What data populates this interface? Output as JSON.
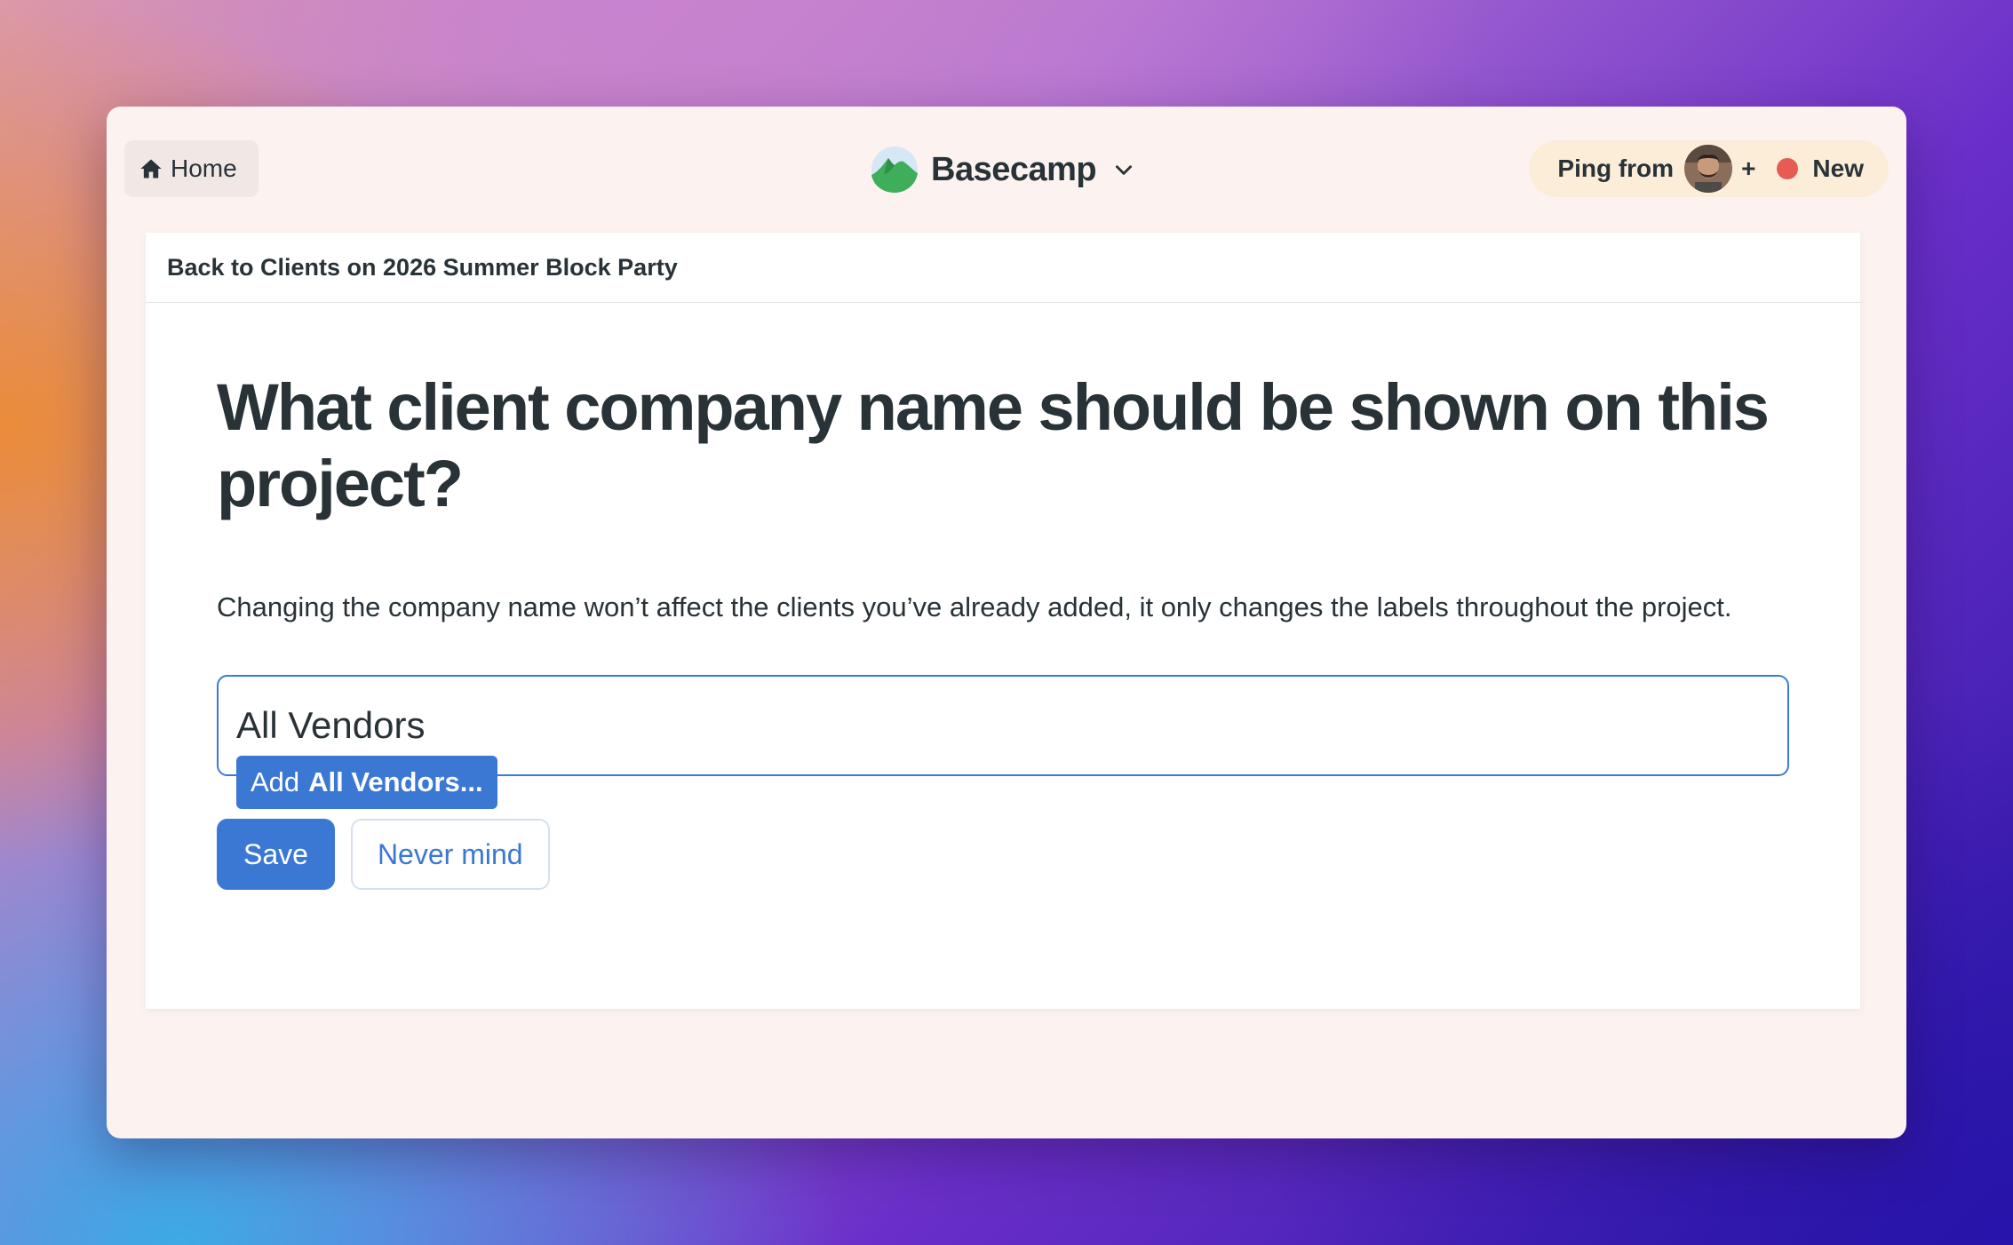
{
  "nav": {
    "home_label": "Home",
    "home_icon": "home-icon",
    "brand_name": "Basecamp",
    "ping_label": "Ping from",
    "plus_label": "+",
    "new_label": "New",
    "new_dot_color": "#e65c55"
  },
  "breadcrumb": {
    "label": "Back to Clients on 2026 Summer Block Party"
  },
  "form": {
    "heading": "What client company name should be shown on this project?",
    "description": "Changing the company name won’t affect the clients you’ve already added, it only changes the labels throughout the project.",
    "input_value": "All Vendors",
    "suggestion_prefix": "Add",
    "suggestion_value": "All Vendors...",
    "save_label": "Save",
    "cancel_label": "Never mind"
  },
  "colors": {
    "accent": "#3a78d4",
    "text": "#283237",
    "window_bg": "#fcf3f1",
    "ping_bg": "#fbedd8"
  }
}
